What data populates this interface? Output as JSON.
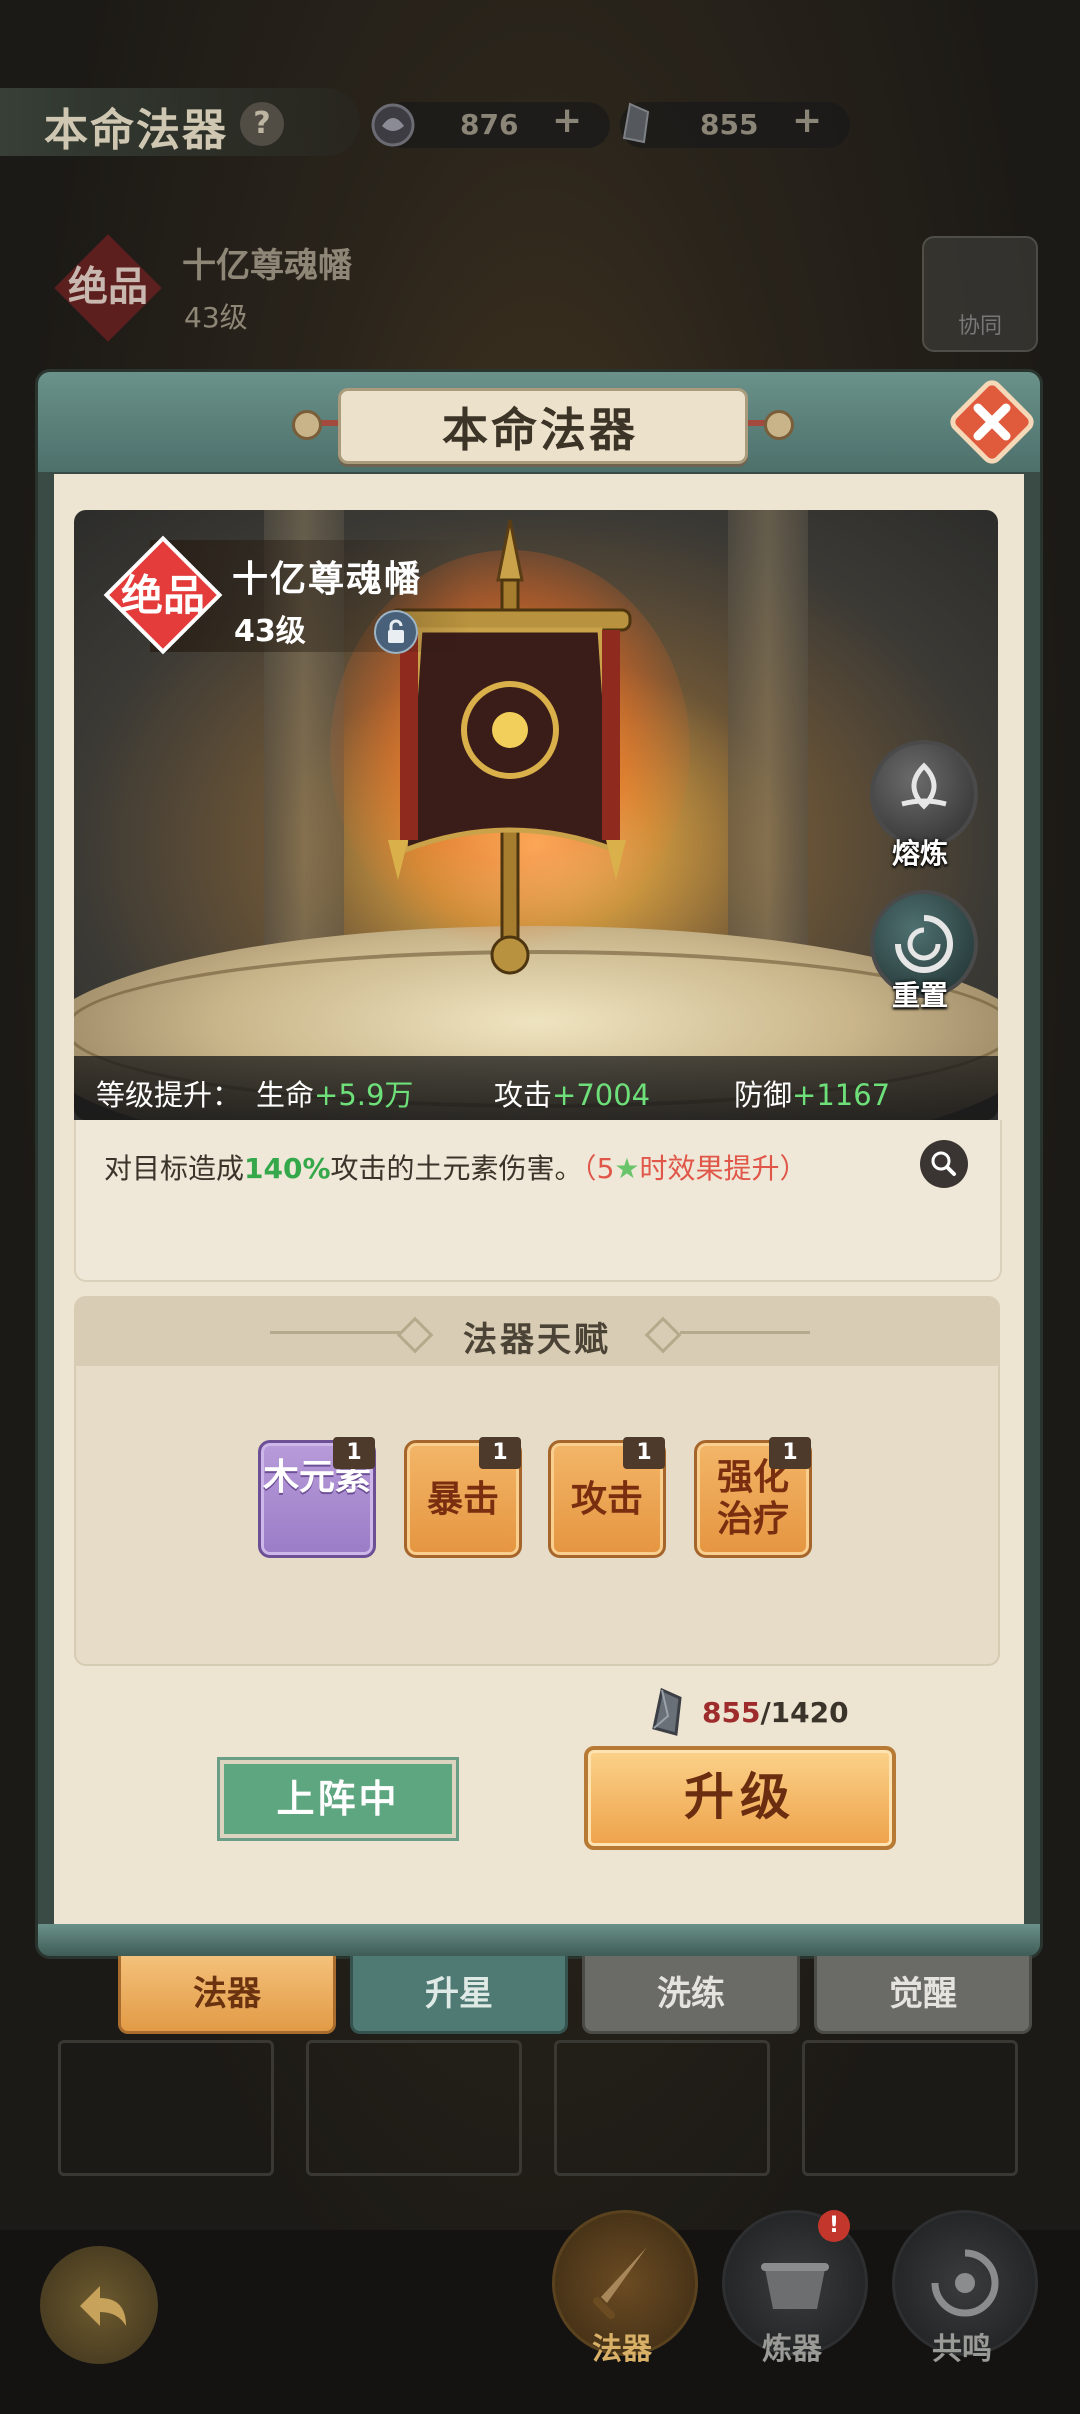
{
  "top_bar": {
    "title": "本命法器",
    "help": "?",
    "resource_1": {
      "icon": "spirit-orb-icon",
      "value": "876",
      "plus": "+"
    },
    "resource_2": {
      "icon": "stone-shard-icon",
      "value": "855",
      "plus": "+"
    }
  },
  "background_info": {
    "rarity_badge": "绝品",
    "artifact_name": "十亿尊魂幡",
    "level": "43级",
    "coop_label": "协同"
  },
  "dialog": {
    "title": "本命法器",
    "artifact": {
      "rarity_badge": "绝品",
      "name": "十亿尊魂幡",
      "level": "43级"
    },
    "side_buttons": [
      {
        "label": "熔炼",
        "icon": "smelt-icon"
      },
      {
        "label": "重置",
        "icon": "reset-icon"
      }
    ],
    "stats": {
      "prefix": "等级提升：",
      "hp_label": "生命",
      "hp_bonus": "+5.9万",
      "atk_label": "攻击",
      "atk_bonus": "+7004",
      "def_label": "防御",
      "def_bonus": "+1167"
    },
    "description": {
      "part1": "对目标造成",
      "percent": "140%",
      "part2": "攻击的土元素伤害。",
      "bracket_open": "（",
      "star_count": "5",
      "star_suffix": "时效果提升",
      "bracket_close": "）"
    },
    "talent": {
      "title": "法器天赋",
      "items": [
        {
          "label": "木元素",
          "level": "1",
          "type": "purple"
        },
        {
          "label": "暴击",
          "level": "1",
          "type": "orange"
        },
        {
          "label": "攻击",
          "level": "1",
          "type": "orange"
        },
        {
          "label": "强化治疗",
          "level": "1",
          "type": "orange"
        }
      ]
    },
    "cost": {
      "have": "855",
      "need": "/1420"
    },
    "deploy_label": "上阵中",
    "upgrade_label": "升级"
  },
  "tabs": [
    "法器",
    "升星",
    "洗练",
    "觉醒"
  ],
  "bottom_nav": [
    {
      "label": "法器",
      "active": true
    },
    {
      "label": "炼器",
      "active": false,
      "badge": "!"
    },
    {
      "label": "共鸣",
      "active": false
    }
  ],
  "colors": {
    "accent_orange": "#eea24a",
    "teal_frame": "#5d8580",
    "bonus_green": "#6ee07a",
    "desc_green": "#34a84a",
    "desc_red": "#e0574a",
    "purple_tile": "#9a7cc7"
  }
}
